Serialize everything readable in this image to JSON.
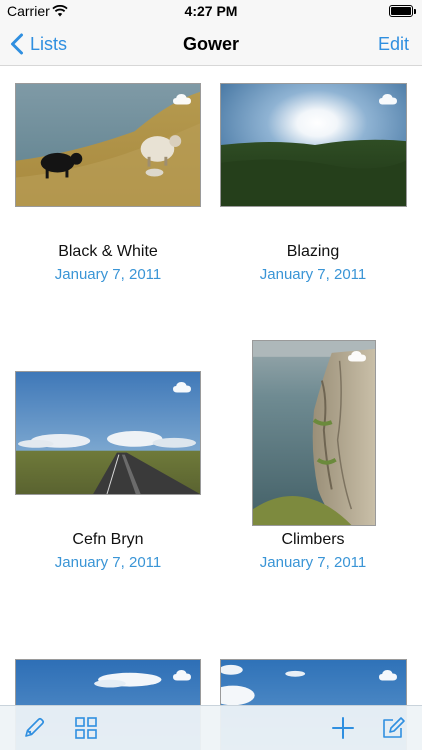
{
  "status_bar": {
    "carrier": "Carrier",
    "time": "4:27 PM",
    "battery_level": 1.0
  },
  "nav": {
    "back_label": "Lists",
    "title": "Gower",
    "edit_label": "Edit"
  },
  "colors": {
    "accent": "#2f8fe0",
    "date_text": "#3a95d6",
    "bar_background": "#f7f7f7"
  },
  "items": [
    {
      "title": "Black & White",
      "date": "January 7, 2011",
      "icon": "cloud-icon"
    },
    {
      "title": "Blazing",
      "date": "January 7, 2011",
      "icon": "cloud-icon"
    },
    {
      "title": "Cefn Bryn",
      "date": "January 7, 2011",
      "icon": "cloud-icon"
    },
    {
      "title": "Climbers",
      "date": "January 7, 2011",
      "icon": "cloud-icon"
    }
  ],
  "toolbar": {
    "icons": [
      "pencil-icon",
      "grid-icon",
      "plus-icon",
      "compose-icon"
    ]
  }
}
